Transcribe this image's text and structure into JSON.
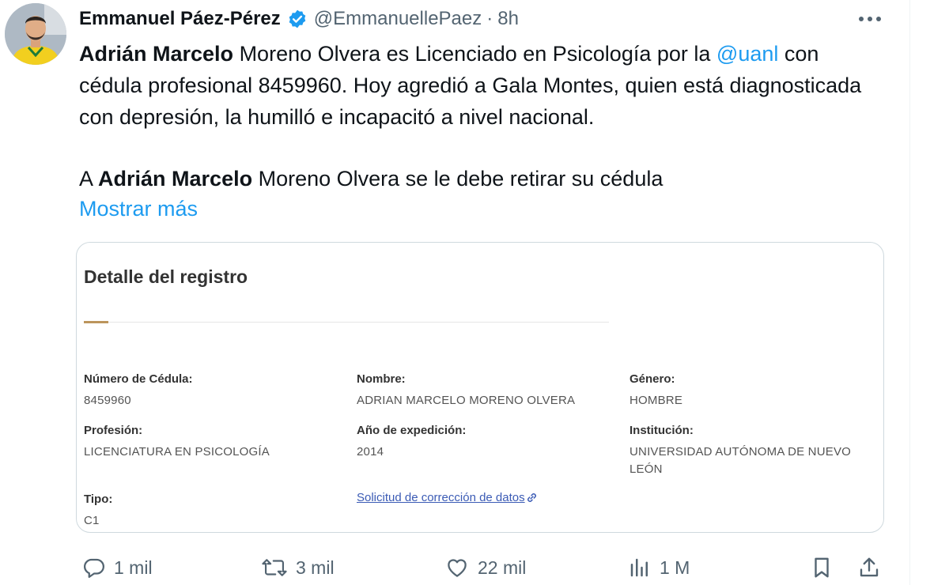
{
  "author": {
    "display_name": "Emmanuel Páez-Pérez",
    "handle": "@EmmanuellePaez",
    "separator": "·",
    "time": "8h"
  },
  "tweet": {
    "p1_name": "Adrián Marcelo",
    "p1_text_a": " Moreno Olvera es Licenciado en Psicología por la ",
    "p1_mention": "@uanl",
    "p1_text_b": " con cédula profesional 8459960. Hoy agredió a Gala Montes, quien está diagnosticada con depresión, la humilló e incapacitó a nivel nacional.",
    "p2_prefix": "A ",
    "p2_name": "Adrián Marcelo",
    "p2_text": " Moreno Olvera se le debe retirar su cédula",
    "show_more": "Mostrar más"
  },
  "card": {
    "title": "Detalle del registro",
    "fields": {
      "cedula_label": "Número de Cédula:",
      "cedula_value": "8459960",
      "nombre_label": "Nombre:",
      "nombre_value": "ADRIAN MARCELO MORENO OLVERA",
      "genero_label": "Género:",
      "genero_value": "HOMBRE",
      "profesion_label": "Profesión:",
      "profesion_value": "LICENCIATURA EN PSICOLOGÍA",
      "anio_label": "Año de expedición:",
      "anio_value": "2014",
      "institucion_label": "Institución:",
      "institucion_value": "UNIVERSIDAD AUTÓNOMA DE NUEVO LEÓN",
      "tipo_label": "Tipo:",
      "tipo_value": "C1"
    },
    "correction_link": "Solicitud de corrección de datos"
  },
  "actions": {
    "replies": "1 mil",
    "reposts": "3 mil",
    "likes": "22 mil",
    "views": "1 M"
  },
  "colors": {
    "accent": "#1d9bf0",
    "text_secondary": "#536471",
    "card_accent": "#bc955c"
  },
  "icons": [
    "verified-icon",
    "more-icon",
    "link-icon",
    "reply-icon",
    "repost-icon",
    "like-icon",
    "views-icon",
    "bookmark-icon",
    "share-icon"
  ]
}
